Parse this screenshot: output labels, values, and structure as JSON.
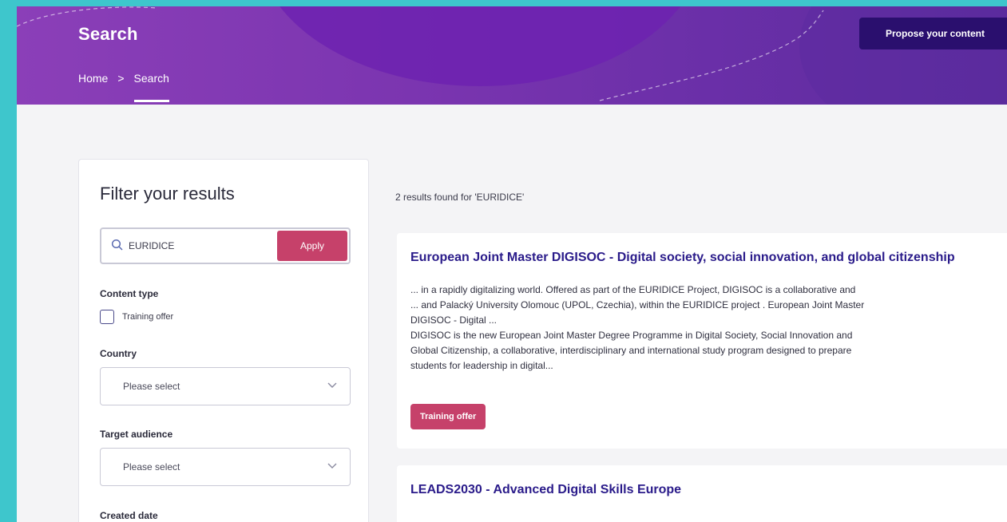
{
  "header": {
    "title": "Search",
    "breadcrumb": {
      "home": "Home",
      "separator": ">",
      "current": "Search"
    },
    "propose_button": "Propose your content"
  },
  "filter": {
    "heading": "Filter your results",
    "search": {
      "value": "EURIDICE",
      "apply_label": "Apply"
    },
    "content_type": {
      "label": "Content type",
      "option": "Training offer"
    },
    "country": {
      "label": "Country",
      "selected": "Please select"
    },
    "target_audience": {
      "label": "Target audience",
      "selected": "Please select"
    },
    "created_date": {
      "label": "Created date"
    }
  },
  "results": {
    "count_text": "2 results found for 'EURIDICE'",
    "items": [
      {
        "title": "European Joint Master DIGISOC - Digital society, social innovation, and global citizenship",
        "snippet_1": "... in a rapidly digitalizing world. Offered as part of the EURIDICE Project, DIGISOC is a collaborative and",
        "snippet_2": "... and Palacký University Olomouc (UPOL, Czechia), within the EURIDICE project . European Joint Master",
        "snippet_3": "DIGISOC - Digital ...",
        "desc_1": "DIGISOC is the new European Joint Master Degree Programme in Digital Society, Social Innovation and",
        "desc_2": "Global Citizenship, a collaborative, interdisciplinary and international study program designed to prepare",
        "desc_3": "students for leadership in digital...",
        "tag": "Training offer"
      },
      {
        "title": "LEADS2030 - Advanced Digital Skills Europe"
      }
    ]
  },
  "colors": {
    "frame_border": "#3ec6cc",
    "header_purple": "#7b35b0",
    "button_navy": "#2a0f6e",
    "accent_pink": "#c6416a",
    "title_blue": "#2a1b8a"
  }
}
